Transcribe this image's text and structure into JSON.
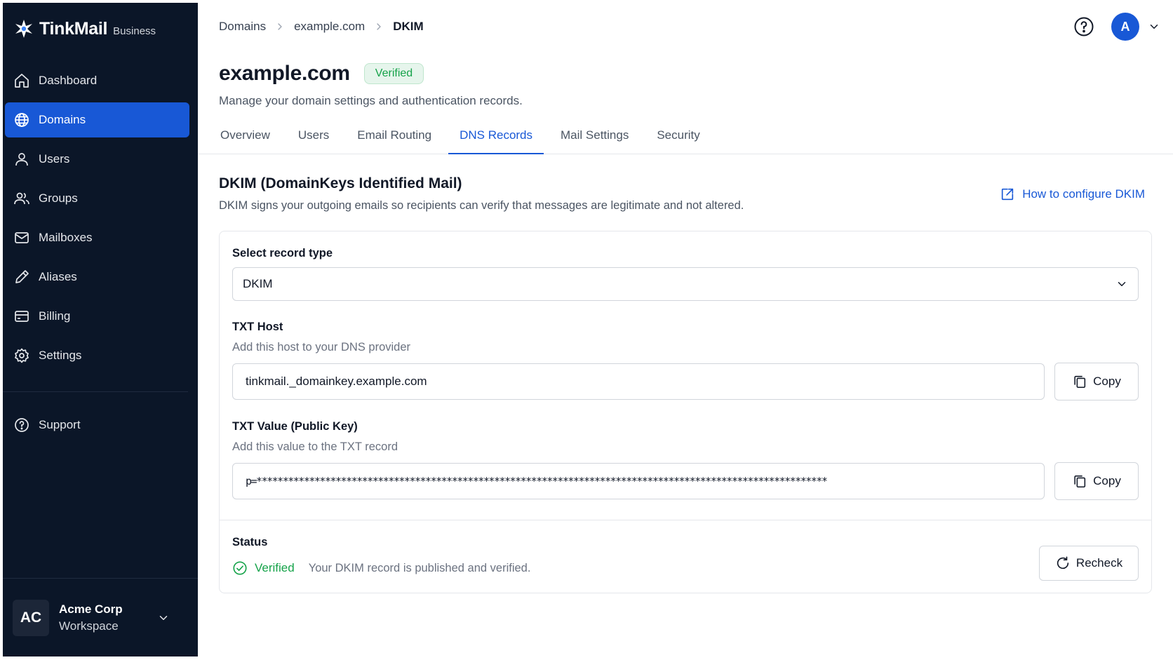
{
  "brand": {
    "name": "TinkMail",
    "tier": "Business"
  },
  "sidebar": {
    "items": [
      {
        "label": "Dashboard",
        "icon": "home-icon"
      },
      {
        "label": "Domains",
        "icon": "globe-icon",
        "active": true
      },
      {
        "label": "Users",
        "icon": "user-icon"
      },
      {
        "label": "Groups",
        "icon": "users-icon"
      },
      {
        "label": "Mailboxes",
        "icon": "mail-icon"
      },
      {
        "label": "Aliases",
        "icon": "pen-icon"
      },
      {
        "label": "Billing",
        "icon": "card-icon"
      },
      {
        "label": "Settings",
        "icon": "gear-icon"
      }
    ],
    "support": {
      "label": "Support",
      "icon": "help-circle-icon"
    },
    "workspace": {
      "initials": "AC",
      "name": "Acme Corp",
      "sub": "Workspace"
    }
  },
  "breadcrumb": [
    "Domains",
    "example.com",
    "DKIM"
  ],
  "user": {
    "initial": "A"
  },
  "header": {
    "title": "example.com",
    "badge": "Verified",
    "subtitle": "Manage your domain settings and authentication records."
  },
  "tabs": [
    "Overview",
    "Users",
    "Email Routing",
    "DNS Records",
    "Mail Settings",
    "Security"
  ],
  "section": {
    "title": "DKIM (DomainKeys Identified Mail)",
    "desc": "DKIM signs your outgoing emails so recipients can verify that messages are legitimate and not altered.",
    "help_link": "How to configure DKIM"
  },
  "form": {
    "record_type_label": "Select record type",
    "record_type_value": "DKIM",
    "host_label": "TXT Host",
    "host_help": "Add this host to your DNS provider",
    "host_value": "tinkmail._domainkey.example.com",
    "value_label": "TXT Value (Public Key)",
    "value_help": "Add this value to the TXT record",
    "value_value": "p=************************************************************************************************************",
    "copy_label": "Copy"
  },
  "status": {
    "label": "Status",
    "state": "Verified",
    "message": "Your DKIM record is published and verified.",
    "recheck_label": "Recheck"
  },
  "colors": {
    "accent": "#1858d6",
    "sidebar_bg": "#0b1628",
    "success": "#16a34a"
  }
}
